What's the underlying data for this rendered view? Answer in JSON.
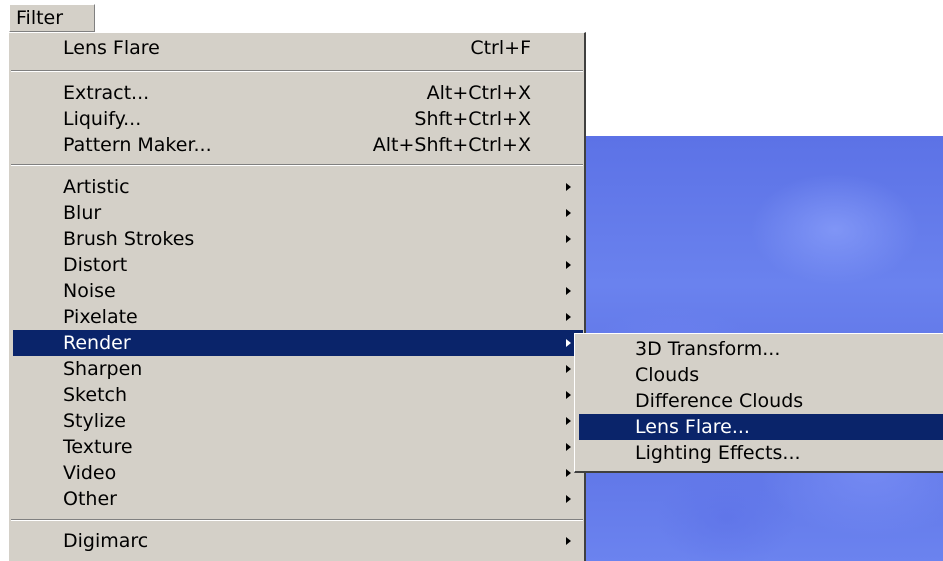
{
  "menubar": {
    "filter_label": "Filter"
  },
  "menu": {
    "last_filter": {
      "label": "Lens Flare",
      "shortcut": "Ctrl+F"
    },
    "extract": {
      "label": "Extract...",
      "shortcut": "Alt+Ctrl+X"
    },
    "liquify": {
      "label": "Liquify...",
      "shortcut": "Shft+Ctrl+X"
    },
    "pattern_maker": {
      "label": "Pattern Maker...",
      "shortcut": "Alt+Shft+Ctrl+X"
    },
    "categories": [
      {
        "label": "Artistic",
        "icon": "chevron-right-icon"
      },
      {
        "label": "Blur",
        "icon": "chevron-right-icon"
      },
      {
        "label": "Brush Strokes",
        "icon": "chevron-right-icon"
      },
      {
        "label": "Distort",
        "icon": "chevron-right-icon"
      },
      {
        "label": "Noise",
        "icon": "chevron-right-icon"
      },
      {
        "label": "Pixelate",
        "icon": "chevron-right-icon"
      },
      {
        "label": "Render",
        "icon": "chevron-right-icon",
        "highlighted": true
      },
      {
        "label": "Sharpen",
        "icon": "chevron-right-icon"
      },
      {
        "label": "Sketch",
        "icon": "chevron-right-icon"
      },
      {
        "label": "Stylize",
        "icon": "chevron-right-icon"
      },
      {
        "label": "Texture",
        "icon": "chevron-right-icon"
      },
      {
        "label": "Video",
        "icon": "chevron-right-icon"
      },
      {
        "label": "Other",
        "icon": "chevron-right-icon"
      }
    ],
    "digimarc": {
      "label": "Digimarc",
      "icon": "chevron-right-icon"
    }
  },
  "render_submenu": {
    "items": [
      {
        "label": "3D Transform..."
      },
      {
        "label": "Clouds"
      },
      {
        "label": "Difference Clouds"
      },
      {
        "label": "Lens Flare...",
        "highlighted": true
      },
      {
        "label": "Lighting Effects..."
      }
    ]
  },
  "colors": {
    "menu_bg": "#d4d0c8",
    "highlight_bg": "#0a246a",
    "highlight_text": "#ffffff",
    "canvas_blue": "#6278e8"
  }
}
